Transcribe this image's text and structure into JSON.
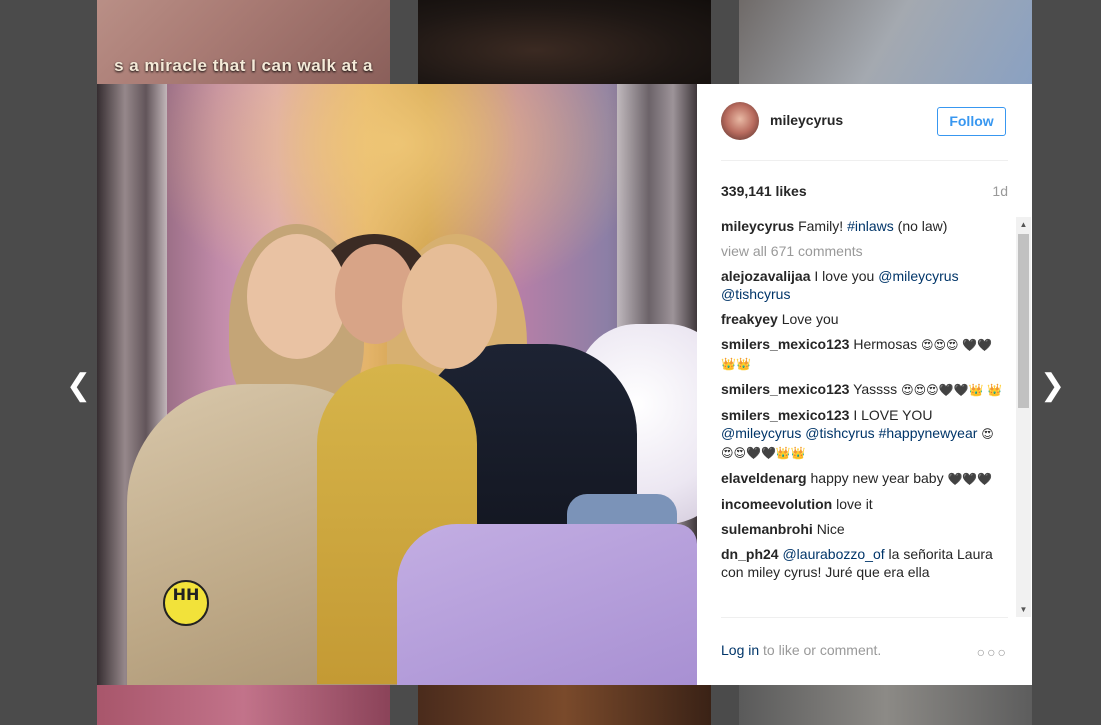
{
  "background_thumbnails": {
    "top_left_caption": "s a miracle that I can walk at a"
  },
  "navigation": {
    "prev_icon": "chevron-left-icon",
    "prev_glyph": "❮",
    "next_icon": "chevron-right-icon",
    "next_glyph": "❯"
  },
  "post": {
    "username": "mileycyrus",
    "follow_label": "Follow",
    "likes": "339,141 likes",
    "time": "1d",
    "view_all": "view all 671 comments",
    "caption": {
      "user": "mileycyrus",
      "text": "Family! ",
      "tag": "#inlaws",
      "text2": " (no law)"
    },
    "comments": [
      {
        "user": "alejozavalijaa",
        "text": "I love you ",
        "link1": "@mileycyrus",
        "mid": " ",
        "link2": "@tishcyrus",
        "emoji": ""
      },
      {
        "user": "freakyey",
        "text": "Love you",
        "link1": "",
        "mid": "",
        "link2": "",
        "emoji": ""
      },
      {
        "user": "smilers_mexico123",
        "text": "Hermosas ",
        "link1": "",
        "mid": "",
        "link2": "",
        "emoji": "😍😍😍 🖤🖤👑👑"
      },
      {
        "user": "smilers_mexico123",
        "text": "Yassss ",
        "link1": "",
        "mid": "",
        "link2": "",
        "emoji": "😍😍😍🖤🖤👑 👑"
      },
      {
        "user": "smilers_mexico123",
        "text": "I LOVE YOU ",
        "link1": "@mileycyrus",
        "mid": " ",
        "link2": "@tishcyrus #happynewyear",
        "emoji": " 😍😍😍🖤🖤👑👑"
      },
      {
        "user": "elaveldenarg",
        "text": "happy new year baby ",
        "link1": "",
        "mid": "",
        "link2": "",
        "emoji": "🖤🖤🖤"
      },
      {
        "user": "incomeevolution",
        "text": "love it",
        "link1": "",
        "mid": "",
        "link2": "",
        "emoji": ""
      },
      {
        "user": "sulemanbrohi",
        "text": "Nice",
        "link1": "",
        "mid": "",
        "link2": "",
        "emoji": ""
      },
      {
        "user": "dn_ph24",
        "text": " la señorita Laura con miley cyrus! Juré que era ella",
        "link1": "@laurabozzo_of",
        "mid": "",
        "link2": "",
        "emoji": ""
      }
    ],
    "footer": {
      "login_link": "Log in",
      "login_text": " to like or comment.",
      "more_icon": "more-options-icon",
      "more_glyph": "○○○"
    }
  },
  "scrollbar": {
    "up_glyph": "▲",
    "down_glyph": "▼"
  },
  "photo": {
    "badge_text": "HH"
  }
}
